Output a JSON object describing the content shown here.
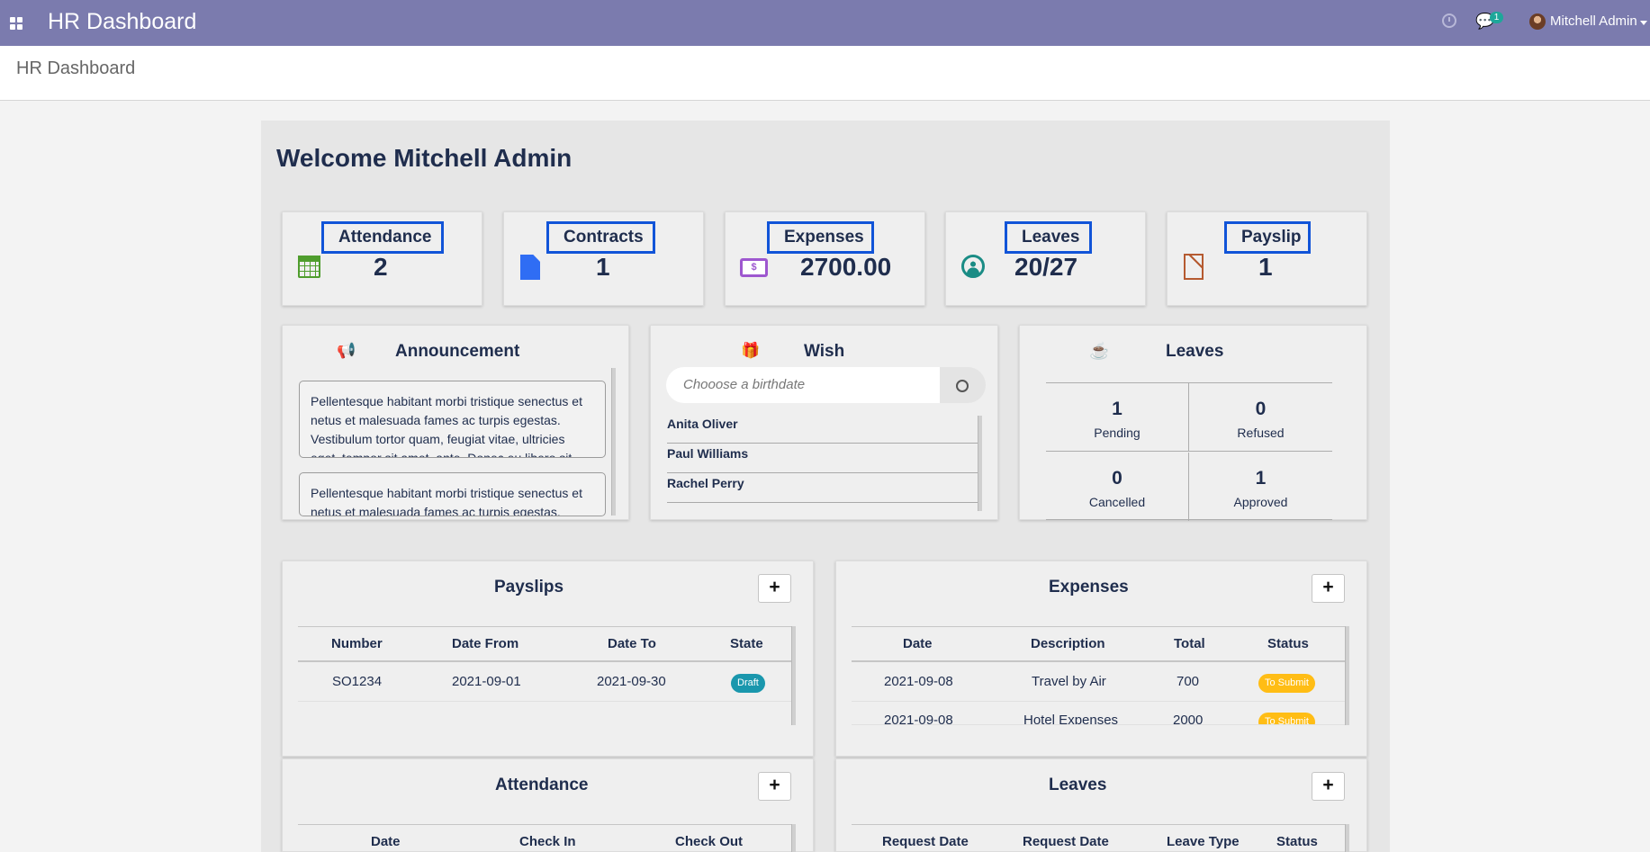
{
  "topbar": {
    "title": "HR Dashboard",
    "message_count": "1",
    "user_name": "Mitchell Admin"
  },
  "breadcrumb": "HR Dashboard",
  "welcome": "Welcome Mitchell Admin",
  "kpis": [
    {
      "title": "Attendance",
      "value": "2",
      "icon": "calendar-icon",
      "color": "#4f9d2d"
    },
    {
      "title": "Contracts",
      "value": "1",
      "icon": "file-icon",
      "color": "#2f6df4"
    },
    {
      "title": "Expenses",
      "value": "2700.00",
      "icon": "money-icon",
      "color": "#9e57cf"
    },
    {
      "title": "Leaves",
      "value": "20/27",
      "icon": "user-circle-icon",
      "color": "#1a8c85"
    },
    {
      "title": "Payslip",
      "value": "1",
      "icon": "document-icon",
      "color": "#b55a30"
    }
  ],
  "announcement": {
    "title": "Announcement",
    "items": [
      "Pellentesque habitant morbi tristique senectus et netus et malesuada fames ac turpis egestas. Vestibulum tortor quam, feugiat vitae, ultricies eget, tempor sit amet, ante. Donec eu libero sit",
      "Pellentesque habitant morbi tristique senectus et netus et malesuada fames ac turpis egestas."
    ]
  },
  "wish": {
    "title": "Wish",
    "placeholder": "Chooose a birthdate",
    "people": [
      "Anita Oliver",
      "Paul Williams",
      "Rachel Perry"
    ]
  },
  "leaves_summary": {
    "title": "Leaves",
    "stats": [
      {
        "value": "1",
        "label": "Pending"
      },
      {
        "value": "0",
        "label": "Refused"
      },
      {
        "value": "0",
        "label": "Cancelled"
      },
      {
        "value": "1",
        "label": "Approved"
      }
    ]
  },
  "payslips": {
    "title": "Payslips",
    "columns": [
      "Number",
      "Date From",
      "Date To",
      "State"
    ],
    "rows": [
      {
        "number": "SO1234",
        "date_from": "2021-09-01",
        "date_to": "2021-09-30",
        "state": "Draft"
      }
    ]
  },
  "expenses": {
    "title": "Expenses",
    "columns": [
      "Date",
      "Description",
      "Total",
      "Status"
    ],
    "rows": [
      {
        "date": "2021-09-08",
        "description": "Travel by Air",
        "total": "700",
        "status": "To Submit"
      },
      {
        "date": "2021-09-08",
        "description": "Hotel Expenses",
        "total": "2000",
        "status": "To Submit"
      }
    ]
  },
  "attendance": {
    "title": "Attendance",
    "columns": [
      "Date",
      "Check In",
      "Check Out"
    ]
  },
  "leaves_table": {
    "title": "Leaves",
    "columns": [
      "Request Date",
      "Request Date",
      "Leave Type",
      "Status"
    ]
  },
  "plus": "+"
}
